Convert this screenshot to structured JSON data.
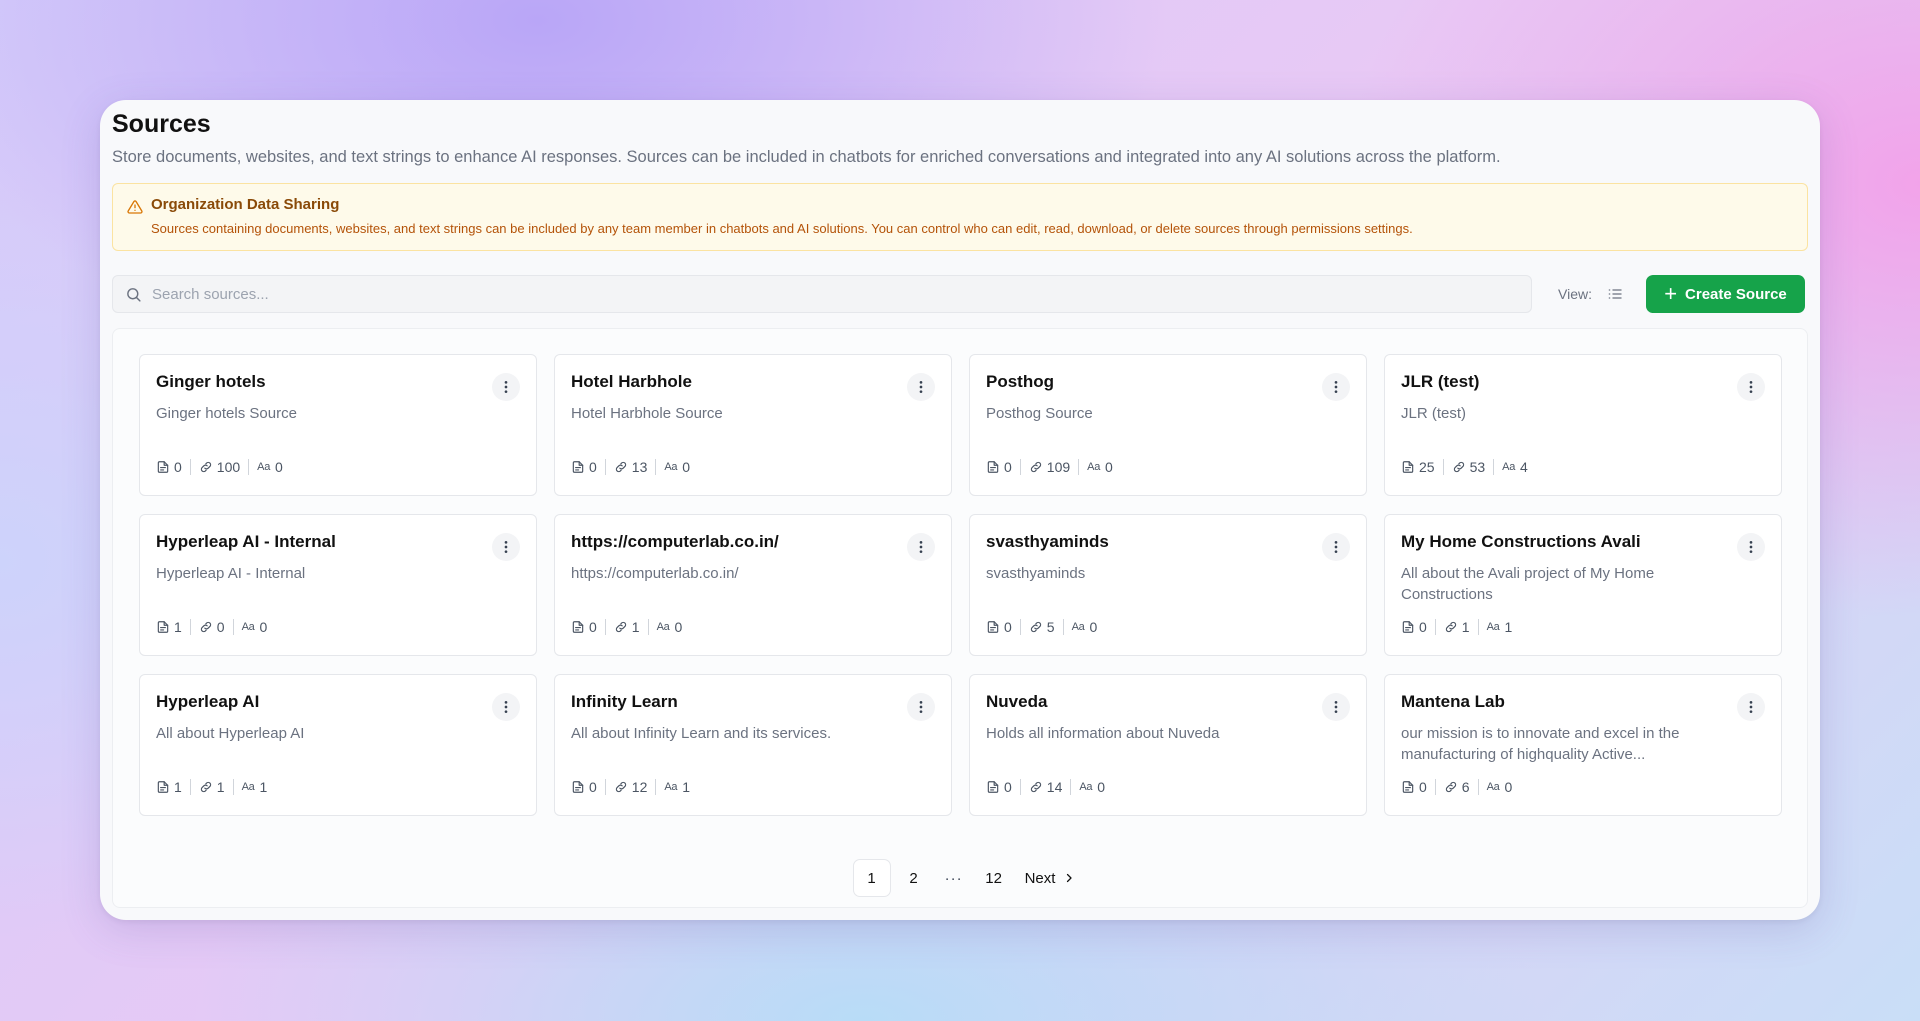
{
  "header": {
    "title": "Sources",
    "description": "Store documents, websites, and text strings to enhance AI responses. Sources can be included in chatbots for enriched conversations and integrated into any AI solutions across the platform."
  },
  "alert": {
    "title": "Organization Data Sharing",
    "text": "Sources containing documents, websites, and text strings can be included by any team member in chatbots and AI solutions. You can control who can edit, read, download, or delete sources through permissions settings.",
    "color": "#b45309"
  },
  "toolbar": {
    "search_placeholder": "Search sources...",
    "view_label": "View:",
    "create_label": "Create Source",
    "create_color": "#16a34a"
  },
  "sources": [
    {
      "title": "Ginger hotels",
      "description": "Ginger hotels Source",
      "docs": "0",
      "links": "100",
      "texts": "0"
    },
    {
      "title": "Hotel Harbhole",
      "description": "Hotel Harbhole Source",
      "docs": "0",
      "links": "13",
      "texts": "0"
    },
    {
      "title": "Posthog",
      "description": "Posthog Source",
      "docs": "0",
      "links": "109",
      "texts": "0"
    },
    {
      "title": "JLR (test)",
      "description": "JLR (test)",
      "docs": "25",
      "links": "53",
      "texts": "4"
    },
    {
      "title": "Hyperleap AI - Internal",
      "description": "Hyperleap AI - Internal",
      "docs": "1",
      "links": "0",
      "texts": "0"
    },
    {
      "title": "https://computerlab.co.in/",
      "description": "https://computerlab.co.in/",
      "docs": "0",
      "links": "1",
      "texts": "0"
    },
    {
      "title": "svasthyaminds",
      "description": "svasthyaminds",
      "docs": "0",
      "links": "5",
      "texts": "0"
    },
    {
      "title": "My Home Constructions Avali",
      "description": "All about the Avali project of My Home Constructions",
      "docs": "0",
      "links": "1",
      "texts": "1"
    },
    {
      "title": "Hyperleap AI",
      "description": "All about Hyperleap AI",
      "docs": "1",
      "links": "1",
      "texts": "1"
    },
    {
      "title": "Infinity Learn",
      "description": "All about Infinity Learn and its services.",
      "docs": "0",
      "links": "12",
      "texts": "1"
    },
    {
      "title": "Nuveda",
      "description": "Holds all information about Nuveda",
      "docs": "0",
      "links": "14",
      "texts": "0"
    },
    {
      "title": "Mantena Lab",
      "description": "our mission is to innovate and excel in the manufacturing of highquality Active...",
      "docs": "0",
      "links": "6",
      "texts": "0"
    }
  ],
  "pagination": {
    "pages": [
      "1",
      "2",
      "12"
    ],
    "ellipsis": "···",
    "current": "1",
    "next_label": "Next"
  },
  "icons": {
    "text_glyph": "Aa"
  }
}
